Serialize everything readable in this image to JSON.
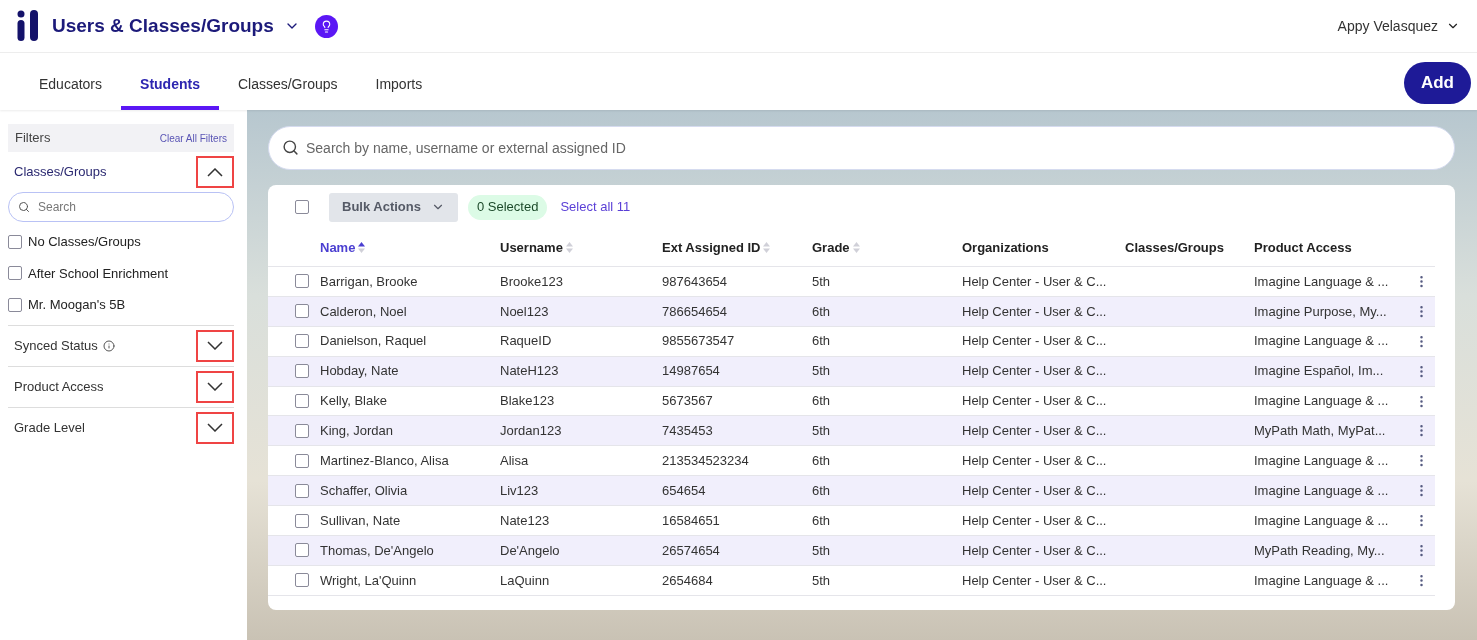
{
  "header": {
    "title": "Users & Classes/Groups",
    "user": "Appy Velasquez"
  },
  "tabs": [
    {
      "label": "Educators",
      "selected": false
    },
    {
      "label": "Students",
      "selected": true
    },
    {
      "label": "Classes/Groups",
      "selected": false
    },
    {
      "label": "Imports",
      "selected": false
    }
  ],
  "add_button": "Add",
  "filters": {
    "title": "Filters",
    "clear": "Clear All Filters",
    "sections": [
      {
        "label": "Classes/Groups",
        "expanded": true,
        "highlighted": true,
        "info": false,
        "search_placeholder": "Search",
        "options": [
          {
            "label": "No Classes/Groups",
            "checked": false
          },
          {
            "label": "After School Enrichment",
            "checked": false
          },
          {
            "label": "Mr. Moogan's 5B",
            "checked": false
          }
        ]
      },
      {
        "label": "Synced Status",
        "expanded": false,
        "highlighted": true,
        "info": true
      },
      {
        "label": "Product Access",
        "expanded": false,
        "highlighted": true,
        "info": false
      },
      {
        "label": "Grade Level",
        "expanded": false,
        "highlighted": true,
        "info": false
      }
    ]
  },
  "search": {
    "placeholder": "Search by name, username or external assigned ID"
  },
  "toolbar": {
    "select_all_checked": false,
    "bulk_actions": "Bulk Actions",
    "selected_count": "0 Selected",
    "select_all_link": "Select all 11"
  },
  "table": {
    "columns": [
      {
        "label": "Name",
        "sortable": true,
        "sorted": true
      },
      {
        "label": "Username",
        "sortable": true,
        "sorted": false
      },
      {
        "label": "Ext Assigned ID",
        "sortable": true,
        "sorted": false
      },
      {
        "label": "Grade",
        "sortable": true,
        "sorted": false
      },
      {
        "label": "Organizations",
        "sortable": false,
        "sorted": false
      },
      {
        "label": "Classes/Groups",
        "sortable": false,
        "sorted": false
      },
      {
        "label": "Product Access",
        "sortable": false,
        "sorted": false
      }
    ],
    "rows": [
      {
        "checked": false,
        "cells": [
          "Barrigan, Brooke",
          "Brooke123",
          "987643654",
          "5th",
          "Help Center - User & C...",
          "",
          "Imagine Language & ..."
        ]
      },
      {
        "checked": false,
        "cells": [
          "Calderon, Noel",
          "Noel123",
          "786654654",
          "6th",
          "Help Center - User & C...",
          "",
          "Imagine Purpose, My..."
        ]
      },
      {
        "checked": false,
        "cells": [
          "Danielson, Raquel",
          "RaqueID",
          "9855673547",
          "6th",
          "Help Center - User & C...",
          "",
          "Imagine Language & ..."
        ]
      },
      {
        "checked": false,
        "cells": [
          "Hobday, Nate",
          "NateH123",
          "14987654",
          "5th",
          "Help Center - User & C...",
          "",
          "Imagine Español, Im..."
        ]
      },
      {
        "checked": false,
        "cells": [
          "Kelly, Blake",
          "Blake123",
          "5673567",
          "6th",
          "Help Center - User & C...",
          "",
          "Imagine Language & ..."
        ]
      },
      {
        "checked": false,
        "cells": [
          "King, Jordan",
          "Jordan123",
          "7435453",
          "5th",
          "Help Center - User & C...",
          "",
          "MyPath Math, MyPat..."
        ]
      },
      {
        "checked": false,
        "cells": [
          "Martinez-Blanco, Alisa",
          "Alisa",
          "213534523234",
          "6th",
          "Help Center - User & C...",
          "",
          "Imagine Language & ..."
        ]
      },
      {
        "checked": false,
        "cells": [
          "Schaffer, Olivia",
          "Liv123",
          "654654",
          "6th",
          "Help Center - User & C...",
          "",
          "Imagine Language & ..."
        ]
      },
      {
        "checked": false,
        "cells": [
          "Sullivan, Nate",
          "Nate123",
          "16584651",
          "6th",
          "Help Center - User & C...",
          "",
          "Imagine Language & ..."
        ]
      },
      {
        "checked": false,
        "cells": [
          "Thomas, De'Angelo",
          "De'Angelo",
          "26574654",
          "5th",
          "Help Center - User & C...",
          "",
          "MyPath Reading, My..."
        ]
      },
      {
        "checked": false,
        "cells": [
          "Wright, La'Quinn",
          "LaQuinn",
          "2654684",
          "5th",
          "Help Center - User & C...",
          "",
          "Imagine Language & ..."
        ]
      }
    ]
  }
}
